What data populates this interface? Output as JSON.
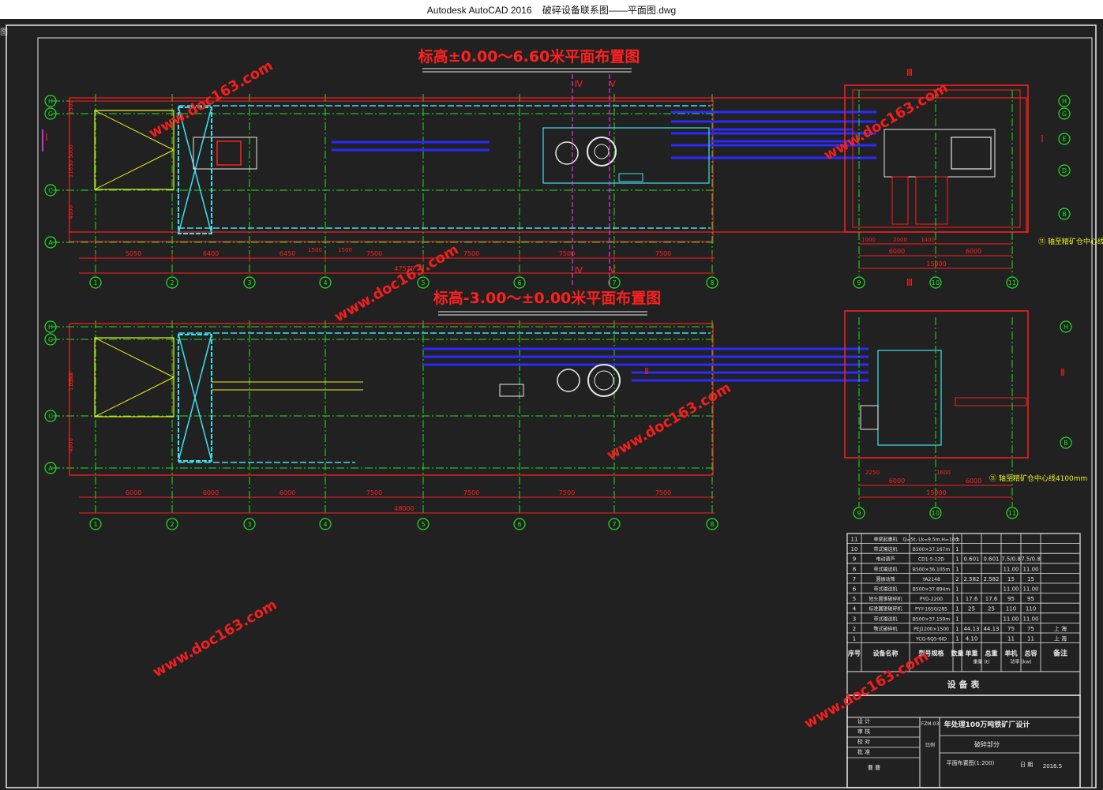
{
  "app": {
    "title": "Autodesk AutoCAD 2016",
    "file": "破碎设备联系图——平面图.dwg",
    "sheet_label": "图"
  },
  "watermark": "www.doc163.com",
  "top_plan": {
    "title": "标高±0.00～6.60米平面布置图",
    "row_axes": [
      "H",
      "G",
      "C",
      "A"
    ],
    "col_axes": [
      "1",
      "2",
      "3",
      "4",
      "5",
      "6",
      "7",
      "8"
    ],
    "dims": [
      "5050",
      "6400",
      "6450",
      "7500",
      "7500",
      "7500",
      "7500"
    ],
    "dims_small": [
      "1500",
      "1500",
      "1500"
    ],
    "total": "47575",
    "section_marks": [
      "Ⅳ",
      "Ⅴ"
    ],
    "left_mark": "Ⅰ",
    "left_dims": [
      "1500",
      "5000",
      "11650",
      "4000"
    ]
  },
  "top_right_plan": {
    "row_axes": [
      "H",
      "G",
      "E",
      "D",
      "B"
    ],
    "col_axes": [
      "9",
      "10",
      "11"
    ],
    "dims": [
      "1000",
      "2000",
      "1400"
    ],
    "dims2": [
      "6000",
      "6000"
    ],
    "total": "15000",
    "section_mark": "Ⅲ",
    "right_mark": "Ⅰ",
    "note": "⑪ 轴至精矿仓中心线4100mm"
  },
  "bottom_plan": {
    "title": "标高-3.00～±0.00米平面布置图",
    "row_axes": [
      "H",
      "G",
      "C",
      "A"
    ],
    "col_axes": [
      "1",
      "2",
      "3",
      "4",
      "5",
      "6",
      "7",
      "8"
    ],
    "dims": [
      "6000",
      "6000",
      "6000",
      "7500",
      "7500",
      "7500",
      "7500"
    ],
    "total": "48000",
    "left_dims": [
      "11650",
      "5500",
      "4000"
    ],
    "left_mark": "Ⅱ"
  },
  "bottom_right_plan": {
    "row_axes": [
      "H",
      "B"
    ],
    "col_axes": [
      "9",
      "10",
      "11"
    ],
    "dims": [
      "2250",
      "1600"
    ],
    "dims2": [
      "6000",
      "6000"
    ],
    "total": "15000",
    "right_mark": "Ⅱ",
    "note": "⑪ 轴至精矿仓中心线4100mm"
  },
  "equipment_table": {
    "caption": "设 备 表",
    "headers": [
      "序号",
      "设备名称",
      "型号规格",
      "数量",
      "单重",
      "总重",
      "单机",
      "总容"
    ],
    "header_sub": [
      "重量 (t)",
      "功率 (kw)"
    ],
    "remark": "备注",
    "rows": [
      {
        "no": "11",
        "name": "单梁起重机",
        "model": "Q=5t, Lk=9.5m,H=10m",
        "qty": "1",
        "w1": "",
        "w2": "",
        "p1": "",
        "p2": "",
        "note": ""
      },
      {
        "no": "10",
        "name": "带式输送机",
        "model": "B500×37.167m",
        "qty": "1",
        "w1": "",
        "w2": "",
        "p1": "",
        "p2": "",
        "note": ""
      },
      {
        "no": "9",
        "name": "电动葫芦",
        "model": "CD1-5-12D",
        "qty": "1",
        "w1": "0.601",
        "w2": "0.601",
        "p1": "7.5/0.8",
        "p2": "7.5/0.8",
        "note": ""
      },
      {
        "no": "8",
        "name": "带式输送机",
        "model": "B500×36.105m",
        "qty": "1",
        "w1": "",
        "w2": "",
        "p1": "11.00",
        "p2": "11.00",
        "note": ""
      },
      {
        "no": "7",
        "name": "圆振动筛",
        "model": "YA2148",
        "qty": "2",
        "w1": "2.582",
        "w2": "2.582",
        "p1": "15",
        "p2": "15",
        "note": ""
      },
      {
        "no": "6",
        "name": "带式输送机",
        "model": "B500×37.894m",
        "qty": "1",
        "w1": "",
        "w2": "",
        "p1": "11.00",
        "p2": "11.00",
        "note": ""
      },
      {
        "no": "5",
        "name": "短头圆锥破碎机",
        "model": "PYD-2200",
        "qty": "1",
        "w1": "17.6",
        "w2": "17.6",
        "p1": "95",
        "p2": "95",
        "note": ""
      },
      {
        "no": "4",
        "name": "标准圆锥破碎机",
        "model": "PYY-1650/285",
        "qty": "1",
        "w1": "25",
        "w2": "25",
        "p1": "110",
        "p2": "110",
        "note": ""
      },
      {
        "no": "3",
        "name": "带式输送机",
        "model": "B500×37.159m",
        "qty": "1",
        "w1": "",
        "w2": "",
        "p1": "11.00",
        "p2": "11.00",
        "note": ""
      },
      {
        "no": "2",
        "name": "颚式破碎机",
        "model": "PEJ1200×1500",
        "qty": "1",
        "w1": "44.13",
        "w2": "44.13",
        "p1": "75",
        "p2": "75",
        "note": "上 海"
      },
      {
        "no": "1",
        "name": "",
        "model": "YCG-6Q5-6ID",
        "qty": "1",
        "w1": "4.10",
        "w2": "",
        "p1": "11",
        "p2": "11",
        "note": "上 海"
      }
    ]
  },
  "title_block": {
    "rows_left": [
      "设 计",
      "审 核",
      "校 对",
      "批 准"
    ],
    "drawing_no_label": "FZM-03",
    "project": "年处理100万吨铁矿厂设计",
    "scale_label": "比例",
    "name_label": "破碎部分",
    "drawing_title": "平面布置图(1:200)",
    "sign": "曹 曹",
    "date_label": "日 期",
    "date": "2016.5"
  },
  "colors": {
    "red": "#ff2020",
    "green": "#22e022",
    "cyan": "#3fe0f0",
    "blue": "#2a2aff",
    "white": "#e8e8e8",
    "yellow": "#f0f020",
    "watermark": "#ff1e1e",
    "bg": "#212121"
  }
}
